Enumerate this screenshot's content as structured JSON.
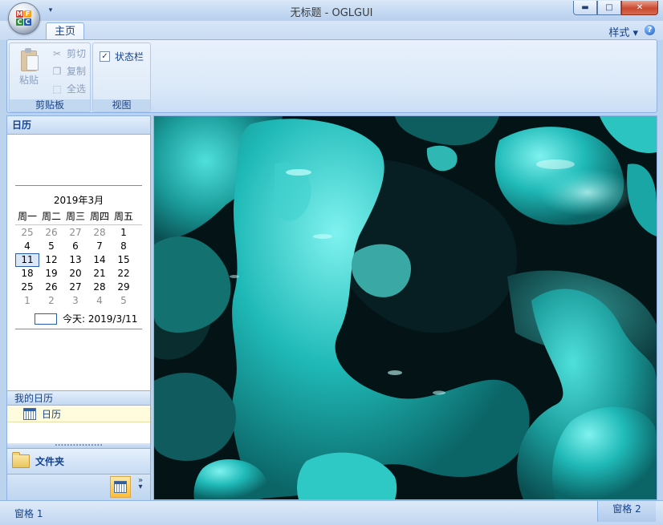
{
  "window": {
    "title": "无标题 - OGLGUI",
    "min_glyph": "▬",
    "max_glyph": "□",
    "close_glyph": "✕",
    "qat_glyph": "▾"
  },
  "app_button": {
    "logo_letters": [
      "M",
      "F",
      "C",
      "C"
    ]
  },
  "ribbon": {
    "tabs": [
      {
        "label": "主页"
      }
    ],
    "style_menu": "样式 ▾",
    "help_glyph": "?",
    "groups": {
      "clipboard": {
        "label": "剪贴板",
        "paste": "粘贴",
        "cut": "剪切",
        "copy": "复制",
        "select_all": "全选"
      },
      "view": {
        "label": "视图",
        "statusbar_checkbox": "状态栏",
        "statusbar_checked": true,
        "check_glyph": "✓"
      }
    }
  },
  "nav_pane": {
    "header": "日历",
    "calendar": {
      "month_title": "2019年3月",
      "weekdays": [
        "周一",
        "周二",
        "周三",
        "周四",
        "周五"
      ],
      "weeks": [
        [
          "25",
          "26",
          "27",
          "28",
          "1"
        ],
        [
          "4",
          "5",
          "6",
          "7",
          "8"
        ],
        [
          "11",
          "12",
          "13",
          "14",
          "15"
        ],
        [
          "18",
          "19",
          "20",
          "21",
          "22"
        ],
        [
          "25",
          "26",
          "27",
          "28",
          "29"
        ],
        [
          "1",
          "2",
          "3",
          "4",
          "5"
        ]
      ],
      "selected_day": "11",
      "today_label": "今天: 2019/3/11"
    },
    "my_calendars_header": "我的日历",
    "my_calendars_item": "日历",
    "splitter_glyph": "∙∙∙∙∙∙∙∙∙∙∙∙∙∙∙∙",
    "folders_button": "文件夹",
    "more_glyph": "»\n▾"
  },
  "status_bar": {
    "pane1": "窗格 1",
    "pane2": "窗格 2"
  },
  "colors": {
    "frame": "#bcd3ee",
    "ribbon_text": "#15428b",
    "accent_orange": "#ffcf5e",
    "scene_teal": "#1fa9a7"
  }
}
